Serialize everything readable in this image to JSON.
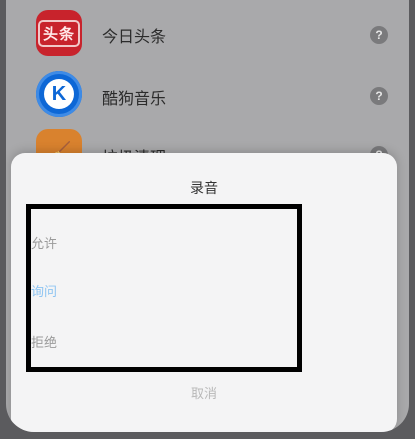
{
  "apps": [
    {
      "label": "今日头条",
      "icon": "toutiao-icon",
      "icon_text": "头条",
      "help": "?"
    },
    {
      "label": "酷狗音乐",
      "icon": "kugou-icon",
      "icon_text": "K",
      "help": "?"
    },
    {
      "label": "垃圾清理",
      "icon": "broom-icon",
      "icon_text": "🧹",
      "help": "?"
    }
  ],
  "sheet": {
    "title": "录音",
    "options": [
      {
        "label": "允许",
        "selected": false
      },
      {
        "label": "询问",
        "selected": true
      },
      {
        "label": "拒绝",
        "selected": false
      }
    ],
    "cancel": "取消"
  },
  "colors": {
    "selected_option": "#8ec4f2",
    "highlight_box": "#000000"
  }
}
